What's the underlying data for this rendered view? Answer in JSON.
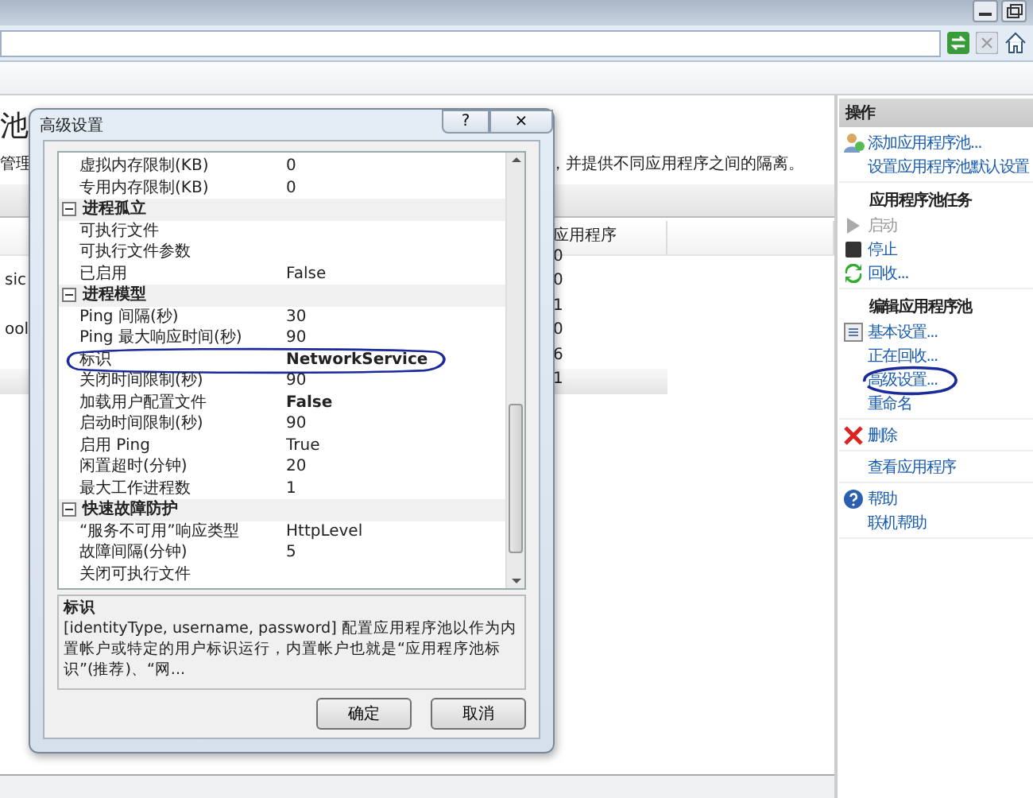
{
  "page": {
    "title": "池",
    "description_start": "管理",
    "description_end": "，并提供不同应用程序之间的隔离。"
  },
  "table": {
    "columns": [
      "应用程序"
    ],
    "rows": [
      {
        "applications": "0",
        "selected": false
      },
      {
        "name": "sic",
        "applications": "0",
        "selected": false
      },
      {
        "applications": "1",
        "selected": false
      },
      {
        "name": "ool",
        "applications": "0",
        "selected": false
      },
      {
        "applications": "6",
        "selected": false
      },
      {
        "applications": "1",
        "selected": true
      }
    ]
  },
  "dialog": {
    "title": "高级设置",
    "help_button": "?",
    "close_button": "×",
    "grid": [
      {
        "kind": "property",
        "name": "虚拟内存限制(KB)",
        "value": "0",
        "modified": false,
        "circled": false
      },
      {
        "kind": "property",
        "name": "专用内存限制(KB)",
        "value": "0",
        "modified": false,
        "circled": false
      },
      {
        "kind": "category",
        "name": "进程孤立",
        "expanded": true
      },
      {
        "kind": "property",
        "name": "可执行文件",
        "circled": false
      },
      {
        "kind": "property",
        "name": "可执行文件参数",
        "circled": false
      },
      {
        "kind": "property",
        "name": "已启用",
        "value": "False",
        "modified": false,
        "circled": false
      },
      {
        "kind": "category",
        "name": "进程模型",
        "expanded": true
      },
      {
        "kind": "property",
        "name": "Ping 间隔(秒)",
        "value": "30",
        "modified": false,
        "circled": false
      },
      {
        "kind": "property",
        "name": "Ping 最大响应时间(秒)",
        "value": "90",
        "modified": false,
        "circled": false
      },
      {
        "kind": "property",
        "name": "标识",
        "value": "NetworkService",
        "modified": true,
        "circled": true
      },
      {
        "kind": "property",
        "name": "关闭时间限制(秒)",
        "value": "90",
        "modified": false,
        "circled": false
      },
      {
        "kind": "property",
        "name": "加载用户配置文件",
        "value": "False",
        "modified": true,
        "circled": false
      },
      {
        "kind": "property",
        "name": "启动时间限制(秒)",
        "value": "90",
        "modified": false,
        "circled": false
      },
      {
        "kind": "property",
        "name": "启用 Ping",
        "value": "True",
        "modified": false,
        "circled": false
      },
      {
        "kind": "property",
        "name": "闲置超时(分钟)",
        "value": "20",
        "modified": false,
        "circled": false
      },
      {
        "kind": "property",
        "name": "最大工作进程数",
        "value": "1",
        "modified": false,
        "circled": false
      },
      {
        "kind": "category",
        "name": "快速故障防护",
        "expanded": true
      },
      {
        "kind": "property",
        "name": "“服务不可用”响应类型",
        "value": "HttpLevel",
        "modified": false,
        "circled": false
      },
      {
        "kind": "property",
        "name": "故障间隔(分钟)",
        "value": "5",
        "modified": false,
        "circled": false
      },
      {
        "kind": "property",
        "name": "关闭可执行文件",
        "circled": false
      }
    ],
    "description": {
      "title": "标识",
      "text": "[identityType, username, password] 配置应用程序池以作为内置帐户或特定的用户标识运行，内置帐户也就是“应用程序池标识”(推荐)、“网..."
    },
    "buttons": [
      "确定",
      "取消"
    ]
  },
  "actions": {
    "title": "操作",
    "groups": [
      {
        "items": [
          {
            "label": "添加应用程序池...",
            "disabled": false,
            "circled": false
          },
          {
            "label": "设置应用程序池默认设置",
            "disabled": false,
            "circled": false
          }
        ]
      },
      {
        "heading": "应用程序池任务",
        "items": [
          {
            "label": "启动",
            "disabled": true,
            "circled": false
          },
          {
            "label": "停止",
            "disabled": false,
            "circled": false
          },
          {
            "label": "回收...",
            "disabled": false,
            "circled": false
          }
        ]
      },
      {
        "heading": "编辑应用程序池",
        "items": [
          {
            "label": "基本设置...",
            "disabled": false,
            "circled": false
          },
          {
            "label": "正在回收...",
            "disabled": false,
            "circled": false
          },
          {
            "label": "高级设置...",
            "disabled": false,
            "circled": true
          },
          {
            "label": "重命名",
            "disabled": false,
            "circled": false
          }
        ]
      },
      {
        "items": [
          {
            "label": "删除",
            "disabled": false,
            "circled": false
          }
        ]
      },
      {
        "items": [
          {
            "label": "查看应用程序",
            "disabled": false,
            "circled": false
          }
        ]
      },
      {
        "items": [
          {
            "label": "帮助",
            "disabled": false,
            "circled": false
          },
          {
            "label": "联机帮助",
            "disabled": false,
            "circled": false
          }
        ]
      }
    ]
  }
}
